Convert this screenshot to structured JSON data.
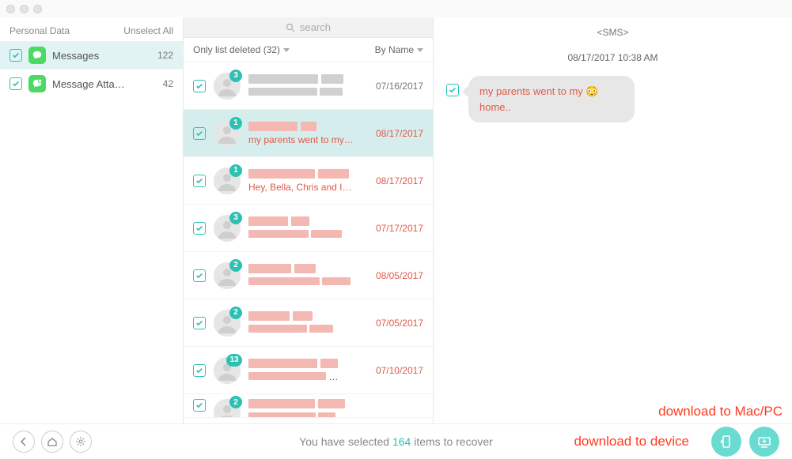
{
  "sidebar": {
    "header": "Personal Data",
    "unselect": "Unselect All",
    "items": [
      {
        "label": "Messages",
        "count": "122"
      },
      {
        "label": "Message Atta…",
        "count": "42"
      }
    ]
  },
  "search": {
    "placeholder": "search"
  },
  "middle": {
    "filter": "Only list deleted (32)",
    "sort": "By Name",
    "rows": [
      {
        "badge": "3",
        "date": "07/16/2017",
        "deleted": false
      },
      {
        "badge": "1",
        "preview": "my parents went to my…",
        "date": "08/17/2017",
        "deleted": true
      },
      {
        "badge": "1",
        "preview": "Hey, Bella, Chris and I…",
        "date": "08/17/2017",
        "deleted": true
      },
      {
        "badge": "3",
        "date": "07/17/2017",
        "deleted": true
      },
      {
        "badge": "2",
        "date": "08/05/2017",
        "deleted": true
      },
      {
        "badge": "2",
        "date": "07/05/2017",
        "deleted": true
      },
      {
        "badge": "13",
        "date": "07/10/2017",
        "deleted": true
      },
      {
        "badge": "2",
        "deleted": true
      }
    ]
  },
  "detail": {
    "type": "<SMS>",
    "timestamp": "08/17/2017 10:38 AM",
    "bubble": "my parents went to my 😳 home.."
  },
  "footer": {
    "prefix": "You have selected ",
    "count": "164",
    "suffix": " items to recover"
  },
  "annotations": {
    "pc": "download to Mac/PC",
    "device": "download to device"
  }
}
